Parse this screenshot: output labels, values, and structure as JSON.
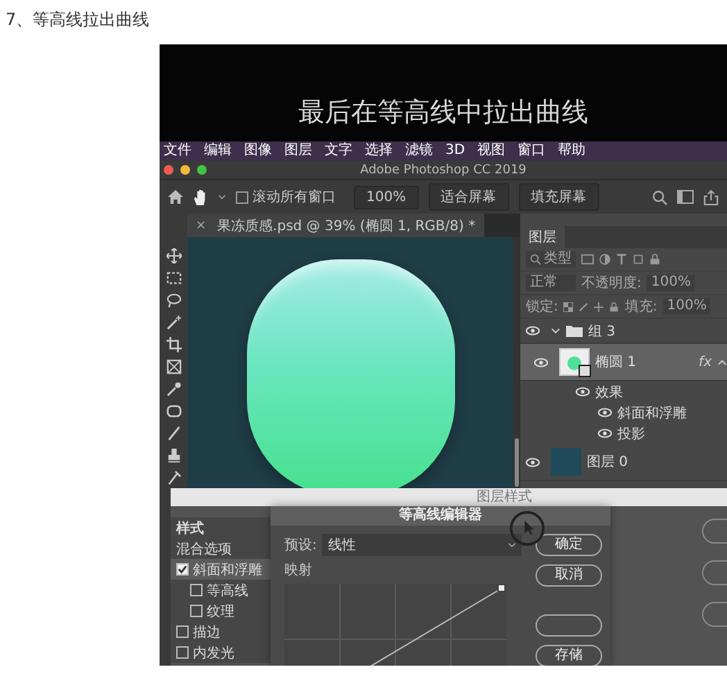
{
  "heading": "7、等高线拉出曲线",
  "video": {
    "subtitle": "最后在等高线中拉出曲线",
    "menu": [
      "文件",
      "编辑",
      "图像",
      "图层",
      "文字",
      "选择",
      "滤镜",
      "3D",
      "视图",
      "窗口",
      "帮助"
    ],
    "app_title": "Adobe Photoshop CC 2019",
    "options_bar": {
      "scroll_all": {
        "label": "滚动所有窗口",
        "checked": false
      },
      "buttons": [
        "100%",
        "适合屏幕",
        "填充屏幕"
      ]
    },
    "document_tab": {
      "close": "×",
      "title": "果冻质感.psd @ 39% (椭圆 1, RGB/8) *"
    },
    "layers_panel": {
      "tab": "图层",
      "filter": "类型",
      "blend_mode": "正常",
      "opacity_label": "不透明度:",
      "opacity": "100%",
      "lock_label": "锁定:",
      "fill_label": "填充:",
      "fill": "100%",
      "layers": [
        {
          "kind": "group",
          "name": "组 3",
          "visible": true,
          "expanded": true,
          "selected": false,
          "children": [
            {
              "kind": "shape",
              "name": "椭圆 1",
              "visible": true,
              "selected": true,
              "fx": "fx",
              "expanded": true,
              "children": [
                {
                  "kind": "effects",
                  "name": "效果",
                  "visible": true,
                  "children": [
                    {
                      "kind": "effect",
                      "name": "斜面和浮雕",
                      "visible": true
                    },
                    {
                      "kind": "effect",
                      "name": "投影",
                      "visible": true
                    }
                  ]
                }
              ]
            }
          ]
        },
        {
          "kind": "pixel",
          "name": "图层 0",
          "visible": true,
          "selected": false
        }
      ]
    },
    "layer_style": {
      "title": "图层样式",
      "styles": [
        {
          "kind": "header",
          "label": "样式",
          "selected": false
        },
        {
          "kind": "plain",
          "label": "混合选项",
          "selected": false
        },
        {
          "kind": "check",
          "label": "斜面和浮雕",
          "checked": true,
          "selected": true
        },
        {
          "kind": "subcheck",
          "label": "等高线",
          "checked": false,
          "selected": false
        },
        {
          "kind": "subcheck",
          "label": "纹理",
          "checked": false,
          "selected": false
        },
        {
          "kind": "check",
          "label": "描边",
          "checked": false,
          "selected": false
        },
        {
          "kind": "check",
          "label": "内发光",
          "checked": false,
          "selected": false
        }
      ]
    },
    "contour_editor": {
      "title": "等高线编辑器",
      "preset_label": "预设:",
      "preset": "线性",
      "mapping_label": "映射",
      "buttons": [
        "确定",
        "取消"
      ],
      "save_button": "存储"
    }
  }
}
